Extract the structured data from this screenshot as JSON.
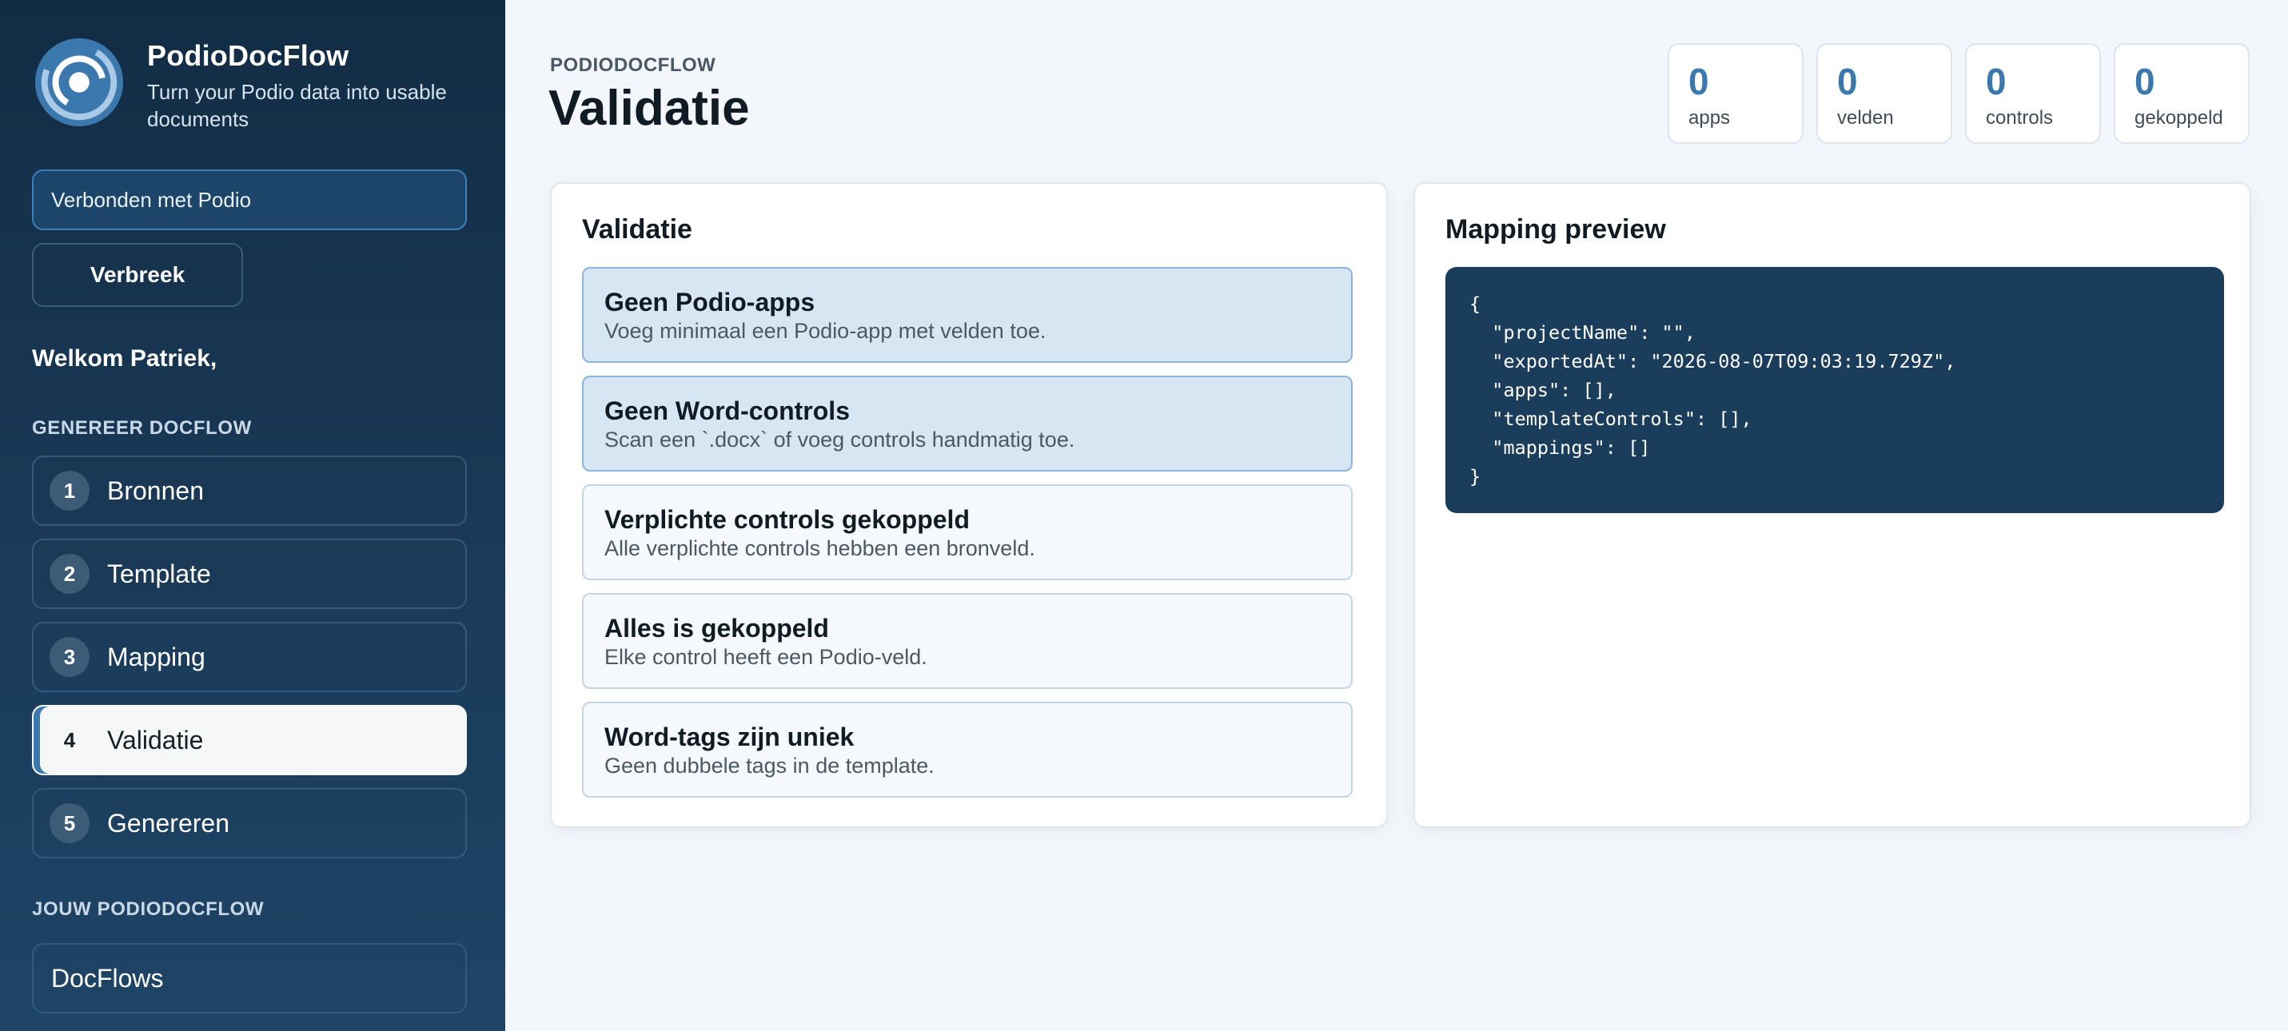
{
  "sidebar": {
    "brand_name": "PodioDocFlow",
    "brand_tagline": "Turn your Podio data into usable documents",
    "connection_status": "Verbonden met Podio",
    "disconnect_label": "Verbreek",
    "welcome": "Welkom Patriek,",
    "generate_section": "GENEREER DOCFLOW",
    "steps": [
      {
        "number": "1",
        "label": "Bronnen"
      },
      {
        "number": "2",
        "label": "Template"
      },
      {
        "number": "3",
        "label": "Mapping"
      },
      {
        "number": "4",
        "label": "Validatie",
        "active": true
      },
      {
        "number": "5",
        "label": "Genereren"
      }
    ],
    "yours_section": "JOUW PODIODOCFLOW",
    "docflows_label": "DocFlows"
  },
  "header": {
    "eyebrow": "PODIODOCFLOW",
    "title": "Validatie"
  },
  "stats": [
    {
      "value": "0",
      "label": "apps"
    },
    {
      "value": "0",
      "label": "velden"
    },
    {
      "value": "0",
      "label": "controls"
    },
    {
      "value": "0",
      "label": "gekoppeld"
    }
  ],
  "validation": {
    "title": "Validatie",
    "checks": [
      {
        "title": "Geen Podio-apps",
        "description": "Voeg minimaal een Podio-app met velden toe.",
        "state": "warning"
      },
      {
        "title": "Geen Word-controls",
        "description": "Scan een `.docx` of voeg controls handmatig toe.",
        "state": "warning"
      },
      {
        "title": "Verplichte controls gekoppeld",
        "description": "Alle verplichte controls hebben een bronveld.",
        "state": "ok"
      },
      {
        "title": "Alles is gekoppeld",
        "description": "Elke control heeft een Podio-veld.",
        "state": "ok"
      },
      {
        "title": "Word-tags zijn uniek",
        "description": "Geen dubbele tags in de template.",
        "state": "ok"
      }
    ]
  },
  "mapping_preview": {
    "title": "Mapping preview",
    "code": "{\n  \"projectName\": \"\",\n  \"exportedAt\": \"2026-08-07T09:03:19.729Z\",\n  \"apps\": [],\n  \"templateControls\": [],\n  \"mappings\": []\n}"
  },
  "colors": {
    "sidebar_bg": "#122c44",
    "accent": "#3a78ad",
    "warning_bg": "#d6e6f3",
    "code_bg": "#1a3d5c"
  },
  "icons": {
    "logo": "podiodocflow-logo-icon"
  }
}
